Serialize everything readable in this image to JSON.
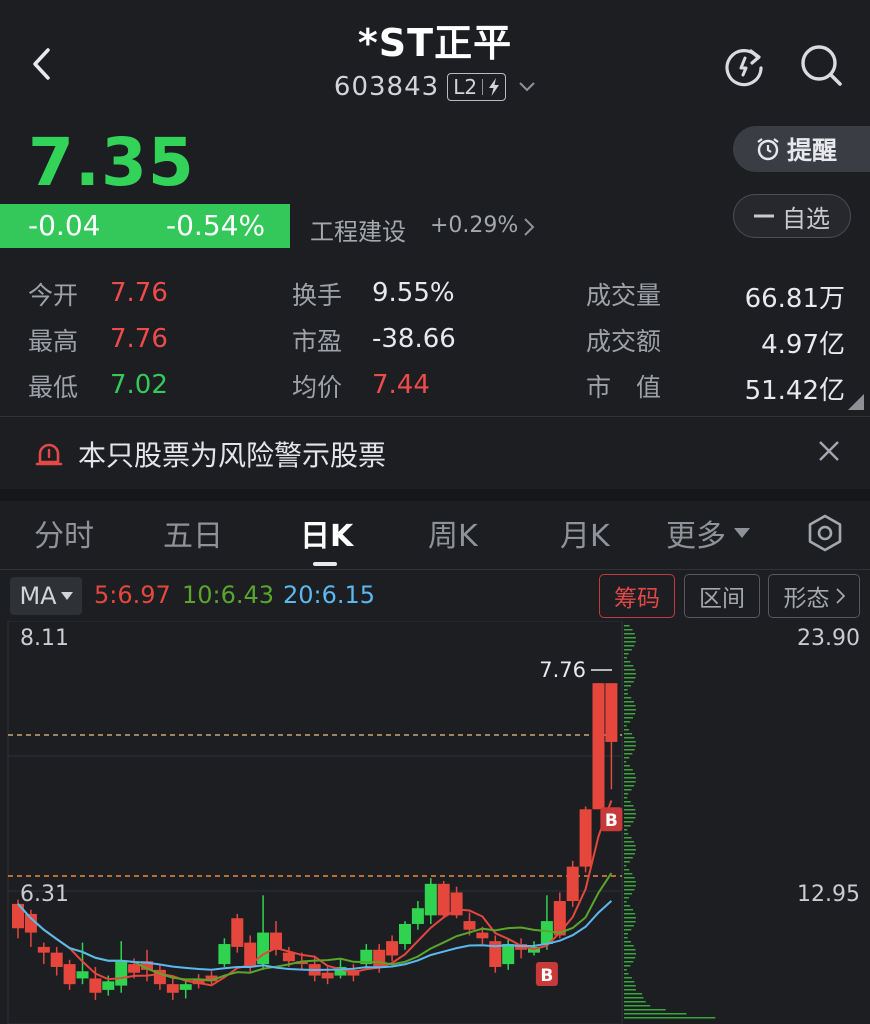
{
  "header": {
    "title": "*ST正平",
    "code": "603843",
    "badge": "L2"
  },
  "quote": {
    "price": "7.35",
    "change": "-0.04",
    "change_pct": "-0.54%",
    "sector": "工程建设",
    "sector_change": "+0.29%"
  },
  "actions": {
    "remind": "提醒",
    "watch": "自选"
  },
  "stats": [
    {
      "label": "今开",
      "value": "7.76",
      "color": "#ee4b4b"
    },
    {
      "label": "最高",
      "value": "7.76",
      "color": "#ee4b4b"
    },
    {
      "label": "最低",
      "value": "7.02",
      "color": "#35c95a"
    },
    {
      "label": "换手",
      "value": "9.55%",
      "color": "#e7e9ee"
    },
    {
      "label": "市盈",
      "value": "-38.66",
      "color": "#e7e9ee"
    },
    {
      "label": "均价",
      "value": "7.44",
      "color": "#ee4b4b"
    },
    {
      "label": "成交量",
      "value": "66.81万",
      "color": "#e7e9ee"
    },
    {
      "label": "成交额",
      "value": "4.97亿",
      "color": "#e7e9ee"
    },
    {
      "label": "市　值",
      "value": "51.42亿",
      "color": "#e7e9ee"
    }
  ],
  "warning": {
    "text": "本只股票为风险警示股票"
  },
  "tabs": [
    {
      "label": "分时",
      "active": false
    },
    {
      "label": "五日",
      "active": false
    },
    {
      "label": "日K",
      "active": true
    },
    {
      "label": "周K",
      "active": false
    },
    {
      "label": "月K",
      "active": false
    },
    {
      "label": "更多",
      "active": false
    }
  ],
  "indicators": {
    "select": "MA",
    "ma5": "5:6.97",
    "ma10": "10:6.43",
    "ma20": "20:6.15",
    "chips": [
      "筹码",
      "区间",
      "形态"
    ],
    "colors": {
      "ma5": "#e5473d",
      "ma10": "#5aa62c",
      "ma20": "#5cb8f0"
    }
  },
  "chart_data": {
    "type": "candlestick",
    "price_axis_labels": [
      "8.11",
      "6.31"
    ],
    "chip_axis_labels": [
      "23.90",
      "12.95"
    ],
    "high_annotation": "7.76",
    "buy_marker": "B",
    "candles": [
      {
        "o": 6.05,
        "c": 6.22,
        "h": 6.25,
        "l": 5.98,
        "up": false
      },
      {
        "o": 6.15,
        "c": 6.02,
        "h": 6.18,
        "l": 5.92,
        "up": false
      },
      {
        "o": 5.92,
        "c": 5.88,
        "h": 5.95,
        "l": 5.8,
        "up": false
      },
      {
        "o": 5.88,
        "c": 5.78,
        "h": 5.92,
        "l": 5.72,
        "up": false
      },
      {
        "o": 5.8,
        "c": 5.66,
        "h": 5.83,
        "l": 5.62,
        "up": false
      },
      {
        "o": 5.7,
        "c": 5.75,
        "h": 5.95,
        "l": 5.66,
        "up": true
      },
      {
        "o": 5.7,
        "c": 5.6,
        "h": 5.78,
        "l": 5.55,
        "up": false
      },
      {
        "o": 5.62,
        "c": 5.68,
        "h": 5.72,
        "l": 5.58,
        "up": true
      },
      {
        "o": 5.65,
        "c": 5.82,
        "h": 5.96,
        "l": 5.6,
        "up": true
      },
      {
        "o": 5.8,
        "c": 5.74,
        "h": 5.84,
        "l": 5.7,
        "up": false
      },
      {
        "o": 5.82,
        "c": 5.76,
        "h": 5.9,
        "l": 5.68,
        "up": false
      },
      {
        "o": 5.76,
        "c": 5.66,
        "h": 5.8,
        "l": 5.62,
        "up": false
      },
      {
        "o": 5.66,
        "c": 5.6,
        "h": 5.72,
        "l": 5.55,
        "up": false
      },
      {
        "o": 5.62,
        "c": 5.66,
        "h": 5.7,
        "l": 5.56,
        "up": true
      },
      {
        "o": 5.7,
        "c": 5.66,
        "h": 5.73,
        "l": 5.63,
        "up": false
      },
      {
        "o": 5.72,
        "c": 5.68,
        "h": 5.75,
        "l": 5.66,
        "up": false
      },
      {
        "o": 5.8,
        "c": 5.94,
        "h": 5.98,
        "l": 5.78,
        "up": true
      },
      {
        "o": 6.12,
        "c": 5.92,
        "h": 6.15,
        "l": 5.88,
        "up": false
      },
      {
        "o": 5.95,
        "c": 5.78,
        "h": 6.0,
        "l": 5.74,
        "up": false
      },
      {
        "o": 5.8,
        "c": 6.02,
        "h": 6.28,
        "l": 5.76,
        "up": true
      },
      {
        "o": 6.02,
        "c": 5.9,
        "h": 6.1,
        "l": 5.86,
        "up": false
      },
      {
        "o": 5.88,
        "c": 5.82,
        "h": 5.92,
        "l": 5.78,
        "up": false
      },
      {
        "o": 5.82,
        "c": 5.8,
        "h": 5.88,
        "l": 5.76,
        "up": false
      },
      {
        "o": 5.8,
        "c": 5.72,
        "h": 5.86,
        "l": 5.68,
        "up": false
      },
      {
        "o": 5.74,
        "c": 5.7,
        "h": 5.79,
        "l": 5.66,
        "up": false
      },
      {
        "o": 5.72,
        "c": 5.78,
        "h": 5.84,
        "l": 5.7,
        "up": true
      },
      {
        "o": 5.76,
        "c": 5.72,
        "h": 5.8,
        "l": 5.68,
        "up": false
      },
      {
        "o": 5.8,
        "c": 5.9,
        "h": 5.94,
        "l": 5.76,
        "up": true
      },
      {
        "o": 5.9,
        "c": 5.78,
        "h": 5.94,
        "l": 5.74,
        "up": false
      },
      {
        "o": 5.96,
        "c": 5.86,
        "h": 6.0,
        "l": 5.82,
        "up": false
      },
      {
        "o": 5.94,
        "c": 6.08,
        "h": 6.1,
        "l": 5.9,
        "up": true
      },
      {
        "o": 6.08,
        "c": 6.19,
        "h": 6.24,
        "l": 6.04,
        "up": true
      },
      {
        "o": 6.14,
        "c": 6.36,
        "h": 6.4,
        "l": 6.08,
        "up": true
      },
      {
        "o": 6.36,
        "c": 6.14,
        "h": 6.38,
        "l": 6.12,
        "up": false
      },
      {
        "o": 6.3,
        "c": 6.14,
        "h": 6.34,
        "l": 6.12,
        "up": false
      },
      {
        "o": 6.1,
        "c": 6.04,
        "h": 6.16,
        "l": 6.0,
        "up": false
      },
      {
        "o": 6.02,
        "c": 5.98,
        "h": 6.06,
        "l": 5.94,
        "up": false
      },
      {
        "o": 5.96,
        "c": 5.78,
        "h": 6.0,
        "l": 5.74,
        "up": false
      },
      {
        "o": 5.8,
        "c": 5.94,
        "h": 5.98,
        "l": 5.76,
        "up": true
      },
      {
        "o": 5.94,
        "c": 5.9,
        "h": 5.98,
        "l": 5.84,
        "up": false
      },
      {
        "o": 5.88,
        "c": 5.92,
        "h": 5.96,
        "l": 5.86,
        "up": true
      },
      {
        "o": 5.94,
        "c": 6.1,
        "h": 6.28,
        "l": 5.9,
        "up": true
      },
      {
        "o": 6.0,
        "c": 6.24,
        "h": 6.3,
        "l": 5.98,
        "up": false
      },
      {
        "o": 6.24,
        "c": 6.48,
        "h": 6.52,
        "l": 6.2,
        "up": false
      },
      {
        "o": 6.48,
        "c": 6.88,
        "h": 6.9,
        "l": 6.44,
        "up": false
      },
      {
        "o": 6.88,
        "c": 7.76,
        "h": 7.76,
        "l": 7.02,
        "up": false
      },
      {
        "o": 7.76,
        "c": 7.35,
        "h": 7.76,
        "l": 7.02,
        "up": false
      }
    ]
  }
}
